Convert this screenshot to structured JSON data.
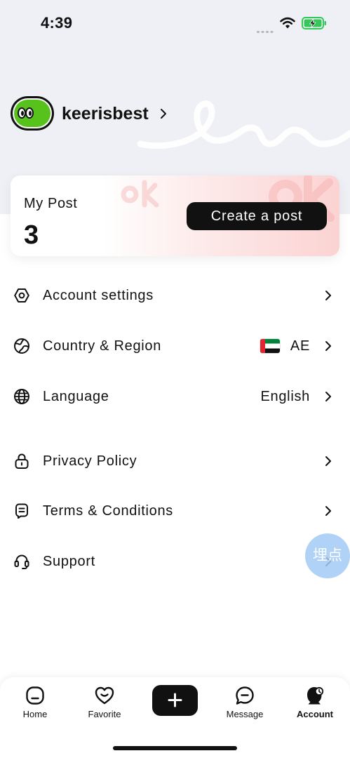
{
  "status_bar": {
    "time": "4:39",
    "icons": [
      "cellular-signal-icon",
      "wifi-icon",
      "battery-charging-icon"
    ]
  },
  "profile": {
    "username": "keerisbest",
    "avatar_icon": "avatar-face-icon"
  },
  "post_card": {
    "title": "My Post",
    "count": "3",
    "create_button_label": "Create a post"
  },
  "menu": {
    "items": [
      {
        "label": "Account settings",
        "icon": "settings-hexagon-icon"
      },
      {
        "label": "Country & Region",
        "icon": "region-globe-icon",
        "flag_icon": "uae-flag-icon",
        "value": "AE"
      },
      {
        "label": "Language",
        "icon": "globe-icon",
        "value": "English"
      },
      {
        "label": "Privacy Policy",
        "icon": "lock-icon"
      },
      {
        "label": "Terms & Conditions",
        "icon": "document-icon"
      },
      {
        "label": "Support",
        "icon": "headset-icon"
      }
    ]
  },
  "floating_button": {
    "label": "埋点"
  },
  "tab_bar": {
    "items": [
      {
        "label": "Home",
        "icon": "home-icon",
        "active": false
      },
      {
        "label": "Favorite",
        "icon": "heart-icon",
        "active": false
      },
      {
        "icon": "plus-icon",
        "active": false
      },
      {
        "label": "Message",
        "icon": "message-icon",
        "active": false
      },
      {
        "label": "Account",
        "icon": "account-icon",
        "active": true
      }
    ]
  },
  "colors": {
    "header_background": "#eff0f5",
    "avatar_green": "#56c21b",
    "card_pink": "#fbd3d2",
    "primary": "#111111",
    "floating_button": "#a3cbf6",
    "battery_green": "#34c759"
  }
}
